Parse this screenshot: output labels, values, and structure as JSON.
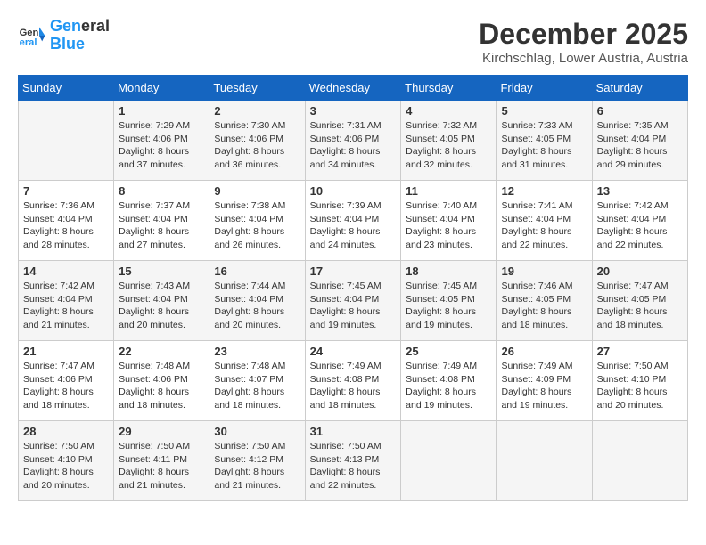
{
  "logo": {
    "line1": "General",
    "line2": "Blue"
  },
  "title": "December 2025",
  "location": "Kirchschlag, Lower Austria, Austria",
  "headers": [
    "Sunday",
    "Monday",
    "Tuesday",
    "Wednesday",
    "Thursday",
    "Friday",
    "Saturday"
  ],
  "weeks": [
    [
      {
        "day": "",
        "sunrise": "",
        "sunset": "",
        "daylight": ""
      },
      {
        "day": "1",
        "sunrise": "Sunrise: 7:29 AM",
        "sunset": "Sunset: 4:06 PM",
        "daylight": "Daylight: 8 hours and 37 minutes."
      },
      {
        "day": "2",
        "sunrise": "Sunrise: 7:30 AM",
        "sunset": "Sunset: 4:06 PM",
        "daylight": "Daylight: 8 hours and 36 minutes."
      },
      {
        "day": "3",
        "sunrise": "Sunrise: 7:31 AM",
        "sunset": "Sunset: 4:06 PM",
        "daylight": "Daylight: 8 hours and 34 minutes."
      },
      {
        "day": "4",
        "sunrise": "Sunrise: 7:32 AM",
        "sunset": "Sunset: 4:05 PM",
        "daylight": "Daylight: 8 hours and 32 minutes."
      },
      {
        "day": "5",
        "sunrise": "Sunrise: 7:33 AM",
        "sunset": "Sunset: 4:05 PM",
        "daylight": "Daylight: 8 hours and 31 minutes."
      },
      {
        "day": "6",
        "sunrise": "Sunrise: 7:35 AM",
        "sunset": "Sunset: 4:04 PM",
        "daylight": "Daylight: 8 hours and 29 minutes."
      }
    ],
    [
      {
        "day": "7",
        "sunrise": "Sunrise: 7:36 AM",
        "sunset": "Sunset: 4:04 PM",
        "daylight": "Daylight: 8 hours and 28 minutes."
      },
      {
        "day": "8",
        "sunrise": "Sunrise: 7:37 AM",
        "sunset": "Sunset: 4:04 PM",
        "daylight": "Daylight: 8 hours and 27 minutes."
      },
      {
        "day": "9",
        "sunrise": "Sunrise: 7:38 AM",
        "sunset": "Sunset: 4:04 PM",
        "daylight": "Daylight: 8 hours and 26 minutes."
      },
      {
        "day": "10",
        "sunrise": "Sunrise: 7:39 AM",
        "sunset": "Sunset: 4:04 PM",
        "daylight": "Daylight: 8 hours and 24 minutes."
      },
      {
        "day": "11",
        "sunrise": "Sunrise: 7:40 AM",
        "sunset": "Sunset: 4:04 PM",
        "daylight": "Daylight: 8 hours and 23 minutes."
      },
      {
        "day": "12",
        "sunrise": "Sunrise: 7:41 AM",
        "sunset": "Sunset: 4:04 PM",
        "daylight": "Daylight: 8 hours and 22 minutes."
      },
      {
        "day": "13",
        "sunrise": "Sunrise: 7:42 AM",
        "sunset": "Sunset: 4:04 PM",
        "daylight": "Daylight: 8 hours and 22 minutes."
      }
    ],
    [
      {
        "day": "14",
        "sunrise": "Sunrise: 7:42 AM",
        "sunset": "Sunset: 4:04 PM",
        "daylight": "Daylight: 8 hours and 21 minutes."
      },
      {
        "day": "15",
        "sunrise": "Sunrise: 7:43 AM",
        "sunset": "Sunset: 4:04 PM",
        "daylight": "Daylight: 8 hours and 20 minutes."
      },
      {
        "day": "16",
        "sunrise": "Sunrise: 7:44 AM",
        "sunset": "Sunset: 4:04 PM",
        "daylight": "Daylight: 8 hours and 20 minutes."
      },
      {
        "day": "17",
        "sunrise": "Sunrise: 7:45 AM",
        "sunset": "Sunset: 4:04 PM",
        "daylight": "Daylight: 8 hours and 19 minutes."
      },
      {
        "day": "18",
        "sunrise": "Sunrise: 7:45 AM",
        "sunset": "Sunset: 4:05 PM",
        "daylight": "Daylight: 8 hours and 19 minutes."
      },
      {
        "day": "19",
        "sunrise": "Sunrise: 7:46 AM",
        "sunset": "Sunset: 4:05 PM",
        "daylight": "Daylight: 8 hours and 18 minutes."
      },
      {
        "day": "20",
        "sunrise": "Sunrise: 7:47 AM",
        "sunset": "Sunset: 4:05 PM",
        "daylight": "Daylight: 8 hours and 18 minutes."
      }
    ],
    [
      {
        "day": "21",
        "sunrise": "Sunrise: 7:47 AM",
        "sunset": "Sunset: 4:06 PM",
        "daylight": "Daylight: 8 hours and 18 minutes."
      },
      {
        "day": "22",
        "sunrise": "Sunrise: 7:48 AM",
        "sunset": "Sunset: 4:06 PM",
        "daylight": "Daylight: 8 hours and 18 minutes."
      },
      {
        "day": "23",
        "sunrise": "Sunrise: 7:48 AM",
        "sunset": "Sunset: 4:07 PM",
        "daylight": "Daylight: 8 hours and 18 minutes."
      },
      {
        "day": "24",
        "sunrise": "Sunrise: 7:49 AM",
        "sunset": "Sunset: 4:08 PM",
        "daylight": "Daylight: 8 hours and 18 minutes."
      },
      {
        "day": "25",
        "sunrise": "Sunrise: 7:49 AM",
        "sunset": "Sunset: 4:08 PM",
        "daylight": "Daylight: 8 hours and 19 minutes."
      },
      {
        "day": "26",
        "sunrise": "Sunrise: 7:49 AM",
        "sunset": "Sunset: 4:09 PM",
        "daylight": "Daylight: 8 hours and 19 minutes."
      },
      {
        "day": "27",
        "sunrise": "Sunrise: 7:50 AM",
        "sunset": "Sunset: 4:10 PM",
        "daylight": "Daylight: 8 hours and 20 minutes."
      }
    ],
    [
      {
        "day": "28",
        "sunrise": "Sunrise: 7:50 AM",
        "sunset": "Sunset: 4:10 PM",
        "daylight": "Daylight: 8 hours and 20 minutes."
      },
      {
        "day": "29",
        "sunrise": "Sunrise: 7:50 AM",
        "sunset": "Sunset: 4:11 PM",
        "daylight": "Daylight: 8 hours and 21 minutes."
      },
      {
        "day": "30",
        "sunrise": "Sunrise: 7:50 AM",
        "sunset": "Sunset: 4:12 PM",
        "daylight": "Daylight: 8 hours and 21 minutes."
      },
      {
        "day": "31",
        "sunrise": "Sunrise: 7:50 AM",
        "sunset": "Sunset: 4:13 PM",
        "daylight": "Daylight: 8 hours and 22 minutes."
      },
      {
        "day": "",
        "sunrise": "",
        "sunset": "",
        "daylight": ""
      },
      {
        "day": "",
        "sunrise": "",
        "sunset": "",
        "daylight": ""
      },
      {
        "day": "",
        "sunrise": "",
        "sunset": "",
        "daylight": ""
      }
    ]
  ]
}
